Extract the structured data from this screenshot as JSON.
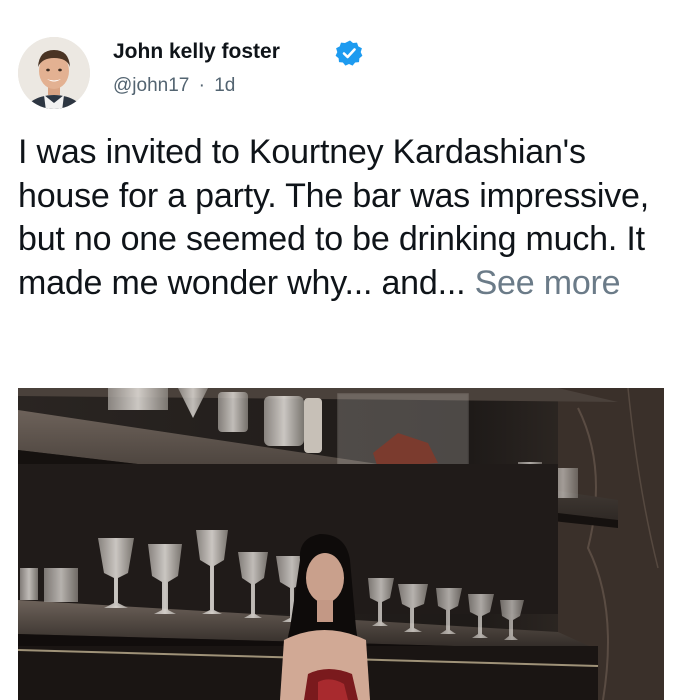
{
  "author": {
    "name": "John kelly foster",
    "handle": "@john17",
    "separator": "·",
    "time": "1d",
    "verified": true,
    "avatar_icon": "profile-photo",
    "badge_color": "#1d9bf0"
  },
  "tweet": {
    "text": "I was invited to Kourtney Kardashian's house for a party. The bar was impressive, but no one seemed to be drinking much. It made me wonder why... and... ",
    "see_more_label": "See more",
    "see_more_color": "#6b7b88"
  },
  "media": {
    "kind": "photo",
    "subject": "bar-shelves-with-glassware"
  }
}
